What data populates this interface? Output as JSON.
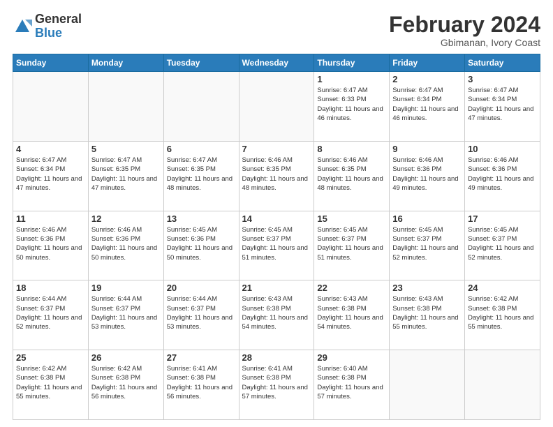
{
  "header": {
    "logo_general": "General",
    "logo_blue": "Blue",
    "month_year": "February 2024",
    "location": "Gbimanan, Ivory Coast"
  },
  "days_of_week": [
    "Sunday",
    "Monday",
    "Tuesday",
    "Wednesday",
    "Thursday",
    "Friday",
    "Saturday"
  ],
  "weeks": [
    [
      {
        "day": "",
        "info": ""
      },
      {
        "day": "",
        "info": ""
      },
      {
        "day": "",
        "info": ""
      },
      {
        "day": "",
        "info": ""
      },
      {
        "day": "1",
        "info": "Sunrise: 6:47 AM\nSunset: 6:33 PM\nDaylight: 11 hours and 46 minutes."
      },
      {
        "day": "2",
        "info": "Sunrise: 6:47 AM\nSunset: 6:34 PM\nDaylight: 11 hours and 46 minutes."
      },
      {
        "day": "3",
        "info": "Sunrise: 6:47 AM\nSunset: 6:34 PM\nDaylight: 11 hours and 47 minutes."
      }
    ],
    [
      {
        "day": "4",
        "info": "Sunrise: 6:47 AM\nSunset: 6:34 PM\nDaylight: 11 hours and 47 minutes."
      },
      {
        "day": "5",
        "info": "Sunrise: 6:47 AM\nSunset: 6:35 PM\nDaylight: 11 hours and 47 minutes."
      },
      {
        "day": "6",
        "info": "Sunrise: 6:47 AM\nSunset: 6:35 PM\nDaylight: 11 hours and 48 minutes."
      },
      {
        "day": "7",
        "info": "Sunrise: 6:46 AM\nSunset: 6:35 PM\nDaylight: 11 hours and 48 minutes."
      },
      {
        "day": "8",
        "info": "Sunrise: 6:46 AM\nSunset: 6:35 PM\nDaylight: 11 hours and 48 minutes."
      },
      {
        "day": "9",
        "info": "Sunrise: 6:46 AM\nSunset: 6:36 PM\nDaylight: 11 hours and 49 minutes."
      },
      {
        "day": "10",
        "info": "Sunrise: 6:46 AM\nSunset: 6:36 PM\nDaylight: 11 hours and 49 minutes."
      }
    ],
    [
      {
        "day": "11",
        "info": "Sunrise: 6:46 AM\nSunset: 6:36 PM\nDaylight: 11 hours and 50 minutes."
      },
      {
        "day": "12",
        "info": "Sunrise: 6:46 AM\nSunset: 6:36 PM\nDaylight: 11 hours and 50 minutes."
      },
      {
        "day": "13",
        "info": "Sunrise: 6:45 AM\nSunset: 6:36 PM\nDaylight: 11 hours and 50 minutes."
      },
      {
        "day": "14",
        "info": "Sunrise: 6:45 AM\nSunset: 6:37 PM\nDaylight: 11 hours and 51 minutes."
      },
      {
        "day": "15",
        "info": "Sunrise: 6:45 AM\nSunset: 6:37 PM\nDaylight: 11 hours and 51 minutes."
      },
      {
        "day": "16",
        "info": "Sunrise: 6:45 AM\nSunset: 6:37 PM\nDaylight: 11 hours and 52 minutes."
      },
      {
        "day": "17",
        "info": "Sunrise: 6:45 AM\nSunset: 6:37 PM\nDaylight: 11 hours and 52 minutes."
      }
    ],
    [
      {
        "day": "18",
        "info": "Sunrise: 6:44 AM\nSunset: 6:37 PM\nDaylight: 11 hours and 52 minutes."
      },
      {
        "day": "19",
        "info": "Sunrise: 6:44 AM\nSunset: 6:37 PM\nDaylight: 11 hours and 53 minutes."
      },
      {
        "day": "20",
        "info": "Sunrise: 6:44 AM\nSunset: 6:37 PM\nDaylight: 11 hours and 53 minutes."
      },
      {
        "day": "21",
        "info": "Sunrise: 6:43 AM\nSunset: 6:38 PM\nDaylight: 11 hours and 54 minutes."
      },
      {
        "day": "22",
        "info": "Sunrise: 6:43 AM\nSunset: 6:38 PM\nDaylight: 11 hours and 54 minutes."
      },
      {
        "day": "23",
        "info": "Sunrise: 6:43 AM\nSunset: 6:38 PM\nDaylight: 11 hours and 55 minutes."
      },
      {
        "day": "24",
        "info": "Sunrise: 6:42 AM\nSunset: 6:38 PM\nDaylight: 11 hours and 55 minutes."
      }
    ],
    [
      {
        "day": "25",
        "info": "Sunrise: 6:42 AM\nSunset: 6:38 PM\nDaylight: 11 hours and 55 minutes."
      },
      {
        "day": "26",
        "info": "Sunrise: 6:42 AM\nSunset: 6:38 PM\nDaylight: 11 hours and 56 minutes."
      },
      {
        "day": "27",
        "info": "Sunrise: 6:41 AM\nSunset: 6:38 PM\nDaylight: 11 hours and 56 minutes."
      },
      {
        "day": "28",
        "info": "Sunrise: 6:41 AM\nSunset: 6:38 PM\nDaylight: 11 hours and 57 minutes."
      },
      {
        "day": "29",
        "info": "Sunrise: 6:40 AM\nSunset: 6:38 PM\nDaylight: 11 hours and 57 minutes."
      },
      {
        "day": "",
        "info": ""
      },
      {
        "day": "",
        "info": ""
      }
    ]
  ]
}
